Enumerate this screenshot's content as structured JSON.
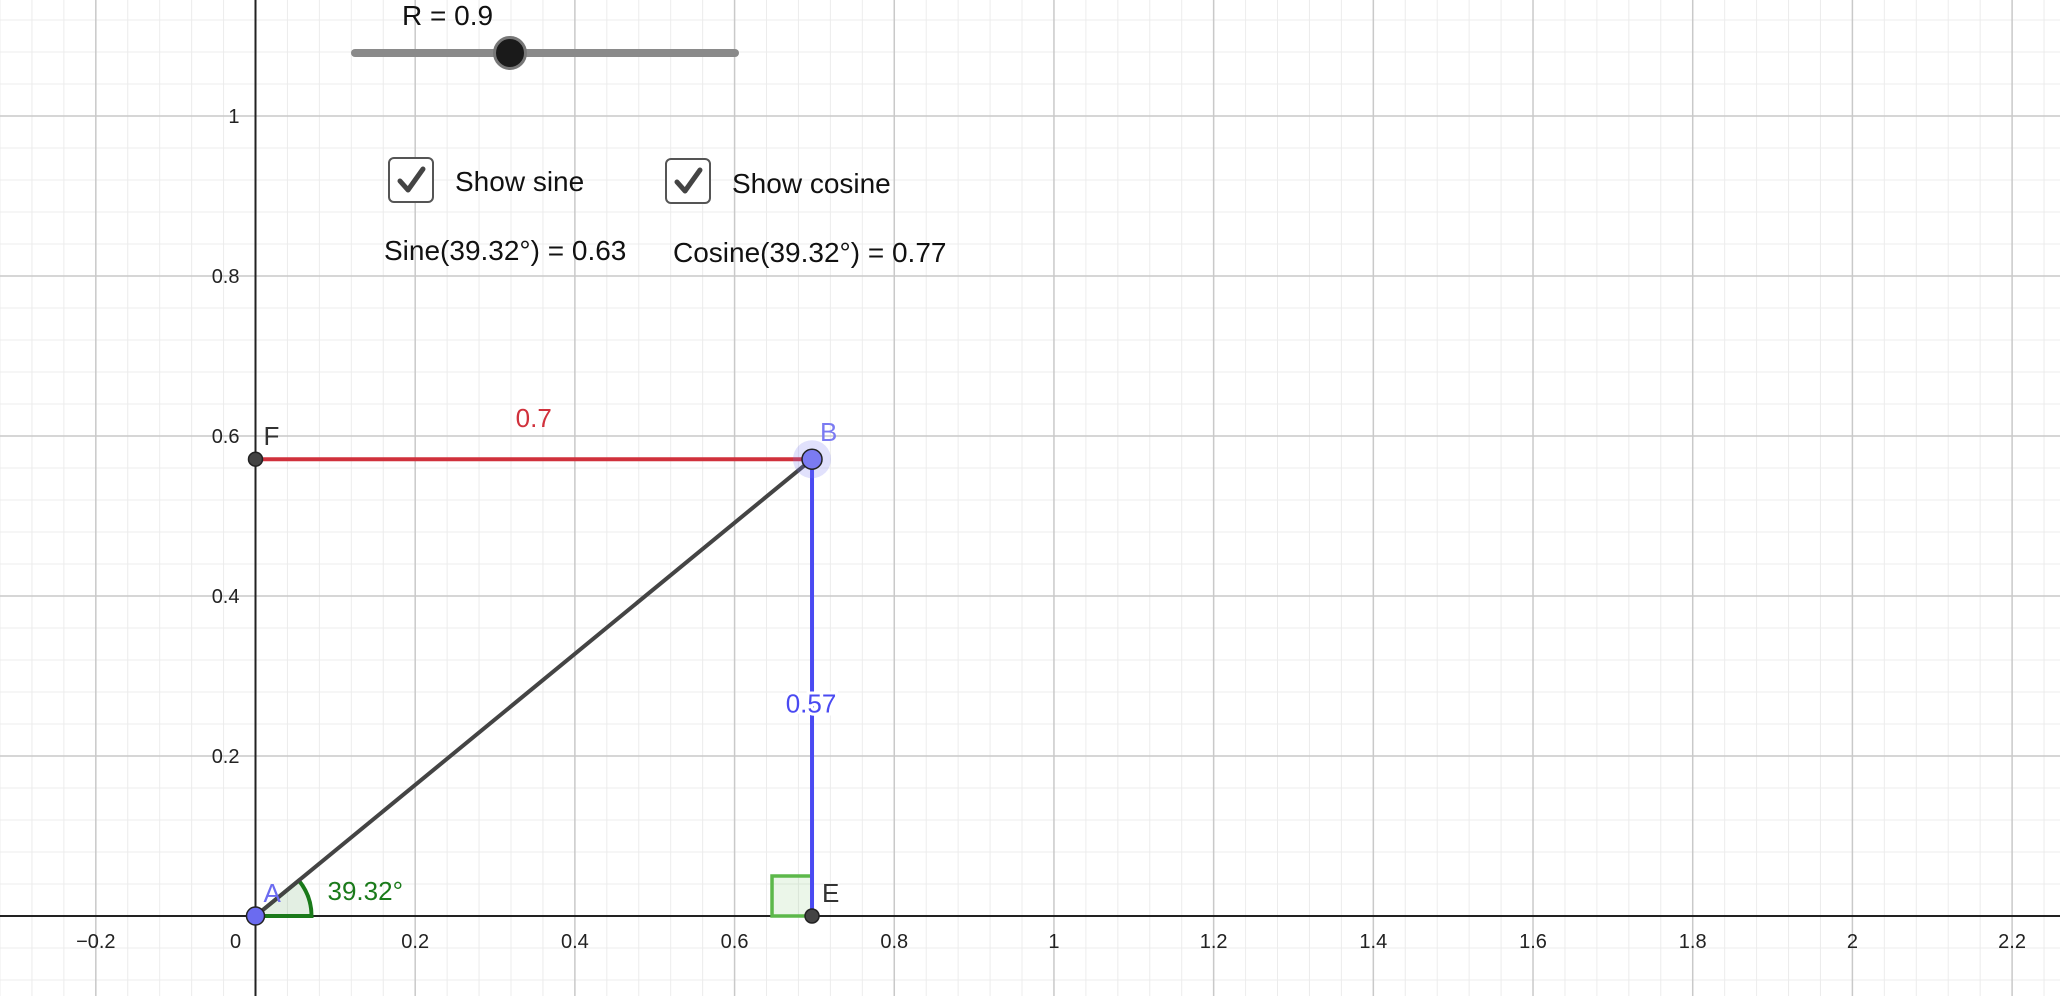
{
  "slider": {
    "label": "R = 0.9",
    "value": 0.9,
    "min": 0,
    "max": 2.2
  },
  "checkboxes": [
    {
      "label": "Show sine",
      "checked": true
    },
    {
      "label": "Show cosine",
      "checked": true
    }
  ],
  "readouts": {
    "sine": "Sine(39.32°) = 0.63",
    "cosine": "Cosine(39.32°) =  0.77"
  },
  "axes": {
    "x_range": [
      -0.32,
      2.26
    ],
    "y_range": [
      -0.1,
      1.145
    ],
    "x_ticks": [
      "−0.2",
      "0",
      "0.2",
      "0.4",
      "0.6",
      "0.8",
      "1",
      "1.2",
      "1.4",
      "1.6",
      "1.8",
      "2",
      "2.2"
    ],
    "x_tick_values": [
      -0.2,
      0,
      0.2,
      0.4,
      0.6,
      0.8,
      1,
      1.2,
      1.4,
      1.6,
      1.8,
      2,
      2.2
    ],
    "y_ticks": [
      "0.2",
      "0.4",
      "0.6",
      "0.8",
      "1"
    ],
    "y_tick_values": [
      0.2,
      0.4,
      0.6,
      0.8,
      1
    ],
    "grid": true
  },
  "points": {
    "A": {
      "label": "A",
      "x": 0,
      "y": 0,
      "color": "#6b6bf0"
    },
    "B": {
      "label": "B",
      "x": 0.697,
      "y": 0.571,
      "color": "#7b7bf2"
    },
    "E": {
      "label": "E",
      "x": 0.697,
      "y": 0,
      "color": "#333333"
    },
    "F": {
      "label": "F",
      "x": 0,
      "y": 0.571,
      "color": "#333333"
    }
  },
  "segments": {
    "cosine_label": "0.7",
    "sine_label": "0.57",
    "cosine_color": "#d0313c",
    "sine_color": "#4a4af2",
    "hypotenuse_color": "#444444"
  },
  "angle": {
    "label": "39.32°",
    "value_deg": 39.32,
    "color": "#1a7a1a"
  },
  "right_angle_color": "#5cb84a"
}
